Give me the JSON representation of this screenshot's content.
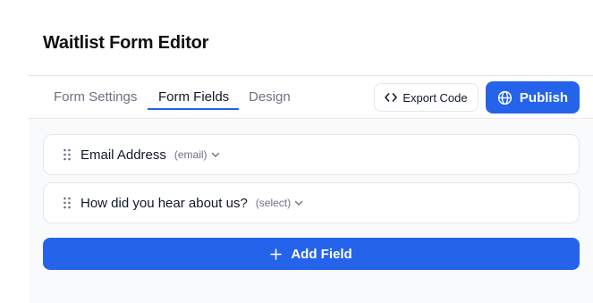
{
  "header": {
    "title": "Waitlist Form Editor"
  },
  "tabs": [
    {
      "label": "Form Settings",
      "active": false
    },
    {
      "label": "Form Fields",
      "active": true
    },
    {
      "label": "Design",
      "active": false
    }
  ],
  "toolbar": {
    "export_label": "Export Code",
    "export_icon": "code-brackets-icon",
    "publish_label": "Publish",
    "publish_icon": "globe-icon"
  },
  "fields": [
    {
      "label": "Email Address",
      "type": "(email)"
    },
    {
      "label": "How did you hear about us?",
      "type": "(select)"
    }
  ],
  "add_field": {
    "label": "Add Field",
    "icon": "plus-icon"
  },
  "colors": {
    "accent": "#2563eb",
    "content_background": "#f9fafb",
    "border": "#e5e7eb",
    "muted_text": "#6b7280"
  }
}
